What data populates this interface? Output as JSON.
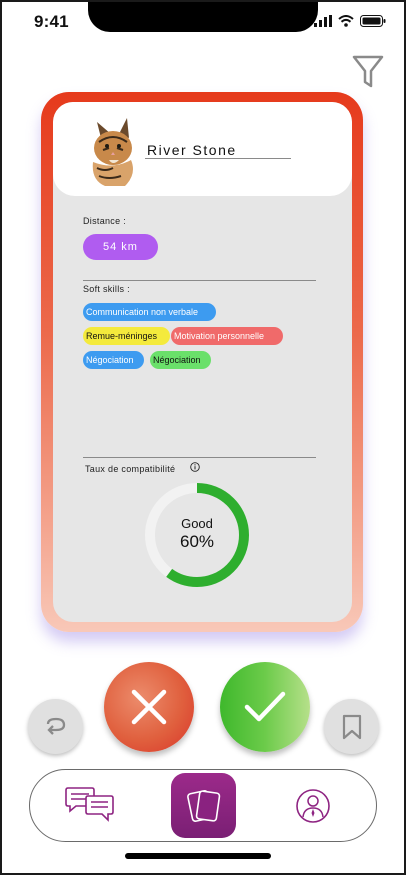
{
  "status_bar": {
    "time": "9:41"
  },
  "profile": {
    "name": "River Stone"
  },
  "distance": {
    "label": "Distance :",
    "value": "54 km"
  },
  "soft_skills": {
    "label": "Soft skills :",
    "items": [
      {
        "label": "Communication non verbale",
        "bg": "#3d9bf0",
        "fg": "#ffffff"
      },
      {
        "label": "Remue-méninges",
        "bg": "#f4ea3c",
        "fg": "#111111"
      },
      {
        "label": "Motivation personnelle",
        "bg": "#f06a6a",
        "fg": "#ffffff"
      },
      {
        "label": "Négociation",
        "bg": "#3d9bf0",
        "fg": "#ffffff"
      },
      {
        "label": "Négociation",
        "bg": "#6ae06a",
        "fg": "#111111"
      }
    ]
  },
  "compatibility": {
    "label": "Taux de compatibilité",
    "rating": "Good",
    "value": "60%",
    "fraction": 0.6
  },
  "icons": {
    "filter": "filter-icon",
    "undo": "undo-icon",
    "reject": "close-icon",
    "accept": "check-icon",
    "save": "bookmark-icon",
    "chat": "chat-icon",
    "cards": "cards-icon",
    "profile": "profile-icon",
    "info": "info-icon"
  },
  "colors": {
    "accent": "#8e2482",
    "gauge": "#2eae2e",
    "distance_badge": "#b05cf0"
  }
}
